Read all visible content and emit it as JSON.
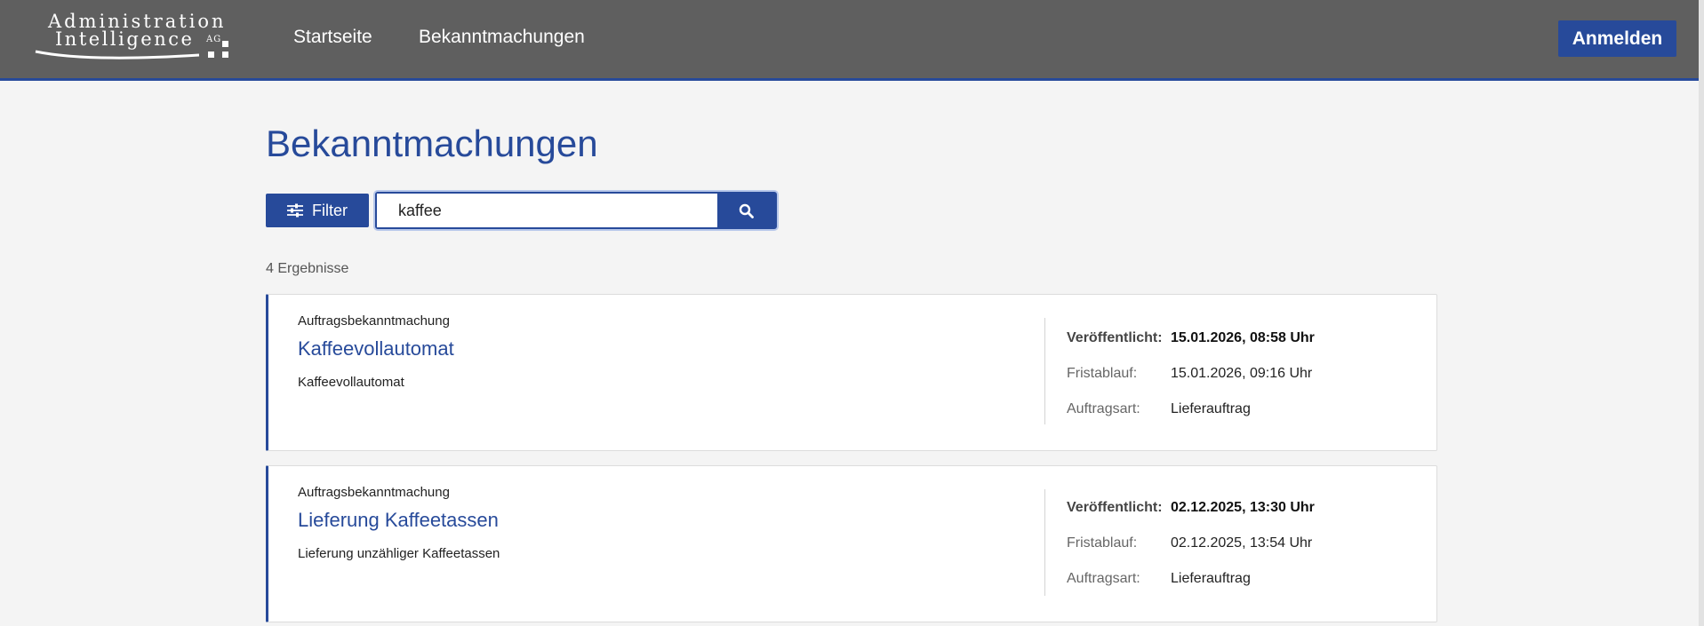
{
  "header": {
    "logo": {
      "line1": "Administration",
      "line2": "Intelligence",
      "suffix": "AG"
    },
    "nav": [
      {
        "label": "Startseite"
      },
      {
        "label": "Bekanntmachungen"
      }
    ],
    "login_label": "Anmelden"
  },
  "main": {
    "title": "Bekanntmachungen",
    "filter_label": "Filter",
    "search": {
      "value": "kaffee",
      "placeholder": ""
    },
    "result_count": "4 Ergebnisse",
    "results": [
      {
        "type": "Auftragsbekanntmachung",
        "title": "Kaffeevollautomat",
        "description": "Kaffeevollautomat",
        "published_label": "Veröffentlicht:",
        "published": "15.01.2026, 08:58 Uhr",
        "deadline_label": "Fristablauf:",
        "deadline": "15.01.2026, 09:16 Uhr",
        "kind_label": "Auftragsart:",
        "kind": "Lieferauftrag"
      },
      {
        "type": "Auftragsbekanntmachung",
        "title": "Lieferung Kaffeetassen",
        "description": "Lieferung unzähliger Kaffeetassen",
        "published_label": "Veröffentlicht:",
        "published": "02.12.2025, 13:30 Uhr",
        "deadline_label": "Fristablauf:",
        "deadline": "02.12.2025, 13:54 Uhr",
        "kind_label": "Auftragsart:",
        "kind": "Lieferauftrag"
      }
    ]
  },
  "colors": {
    "header_bg": "#5f5f5f",
    "accent": "#274a9a",
    "page_bg": "#f4f4f4"
  },
  "icons": {
    "filter": "sliders-icon",
    "search": "search-icon"
  }
}
